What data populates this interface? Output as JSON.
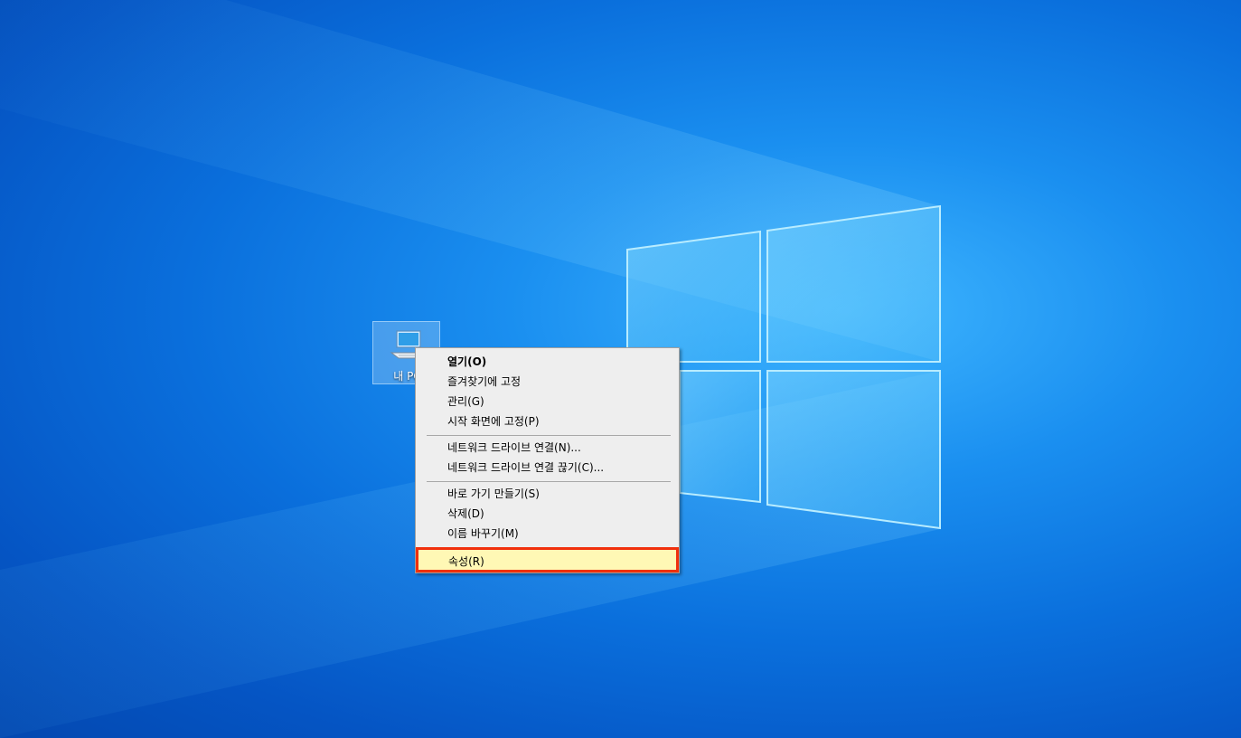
{
  "desktop": {
    "icon_label": "내 PC",
    "icon_name": "computer-icon"
  },
  "context_menu": {
    "items": [
      {
        "label": "열기(O)",
        "bold": true
      },
      {
        "label": "즐겨찾기에 고정"
      },
      {
        "label": "관리(G)"
      },
      {
        "label": "시작 화면에 고정(P)"
      },
      {
        "label": "네트워크 드라이브 연결(N)..."
      },
      {
        "label": "네트워크 드라이브 연결 끊기(C)..."
      },
      {
        "label": "바로 가기 만들기(S)"
      },
      {
        "label": "삭제(D)"
      },
      {
        "label": "이름 바꾸기(M)"
      },
      {
        "label": "속성(R)",
        "highlighted": true
      }
    ]
  },
  "colors": {
    "highlight_border": "#f0300c",
    "highlight_fill": "#fff8b5",
    "menu_bg": "#eeeeee"
  }
}
